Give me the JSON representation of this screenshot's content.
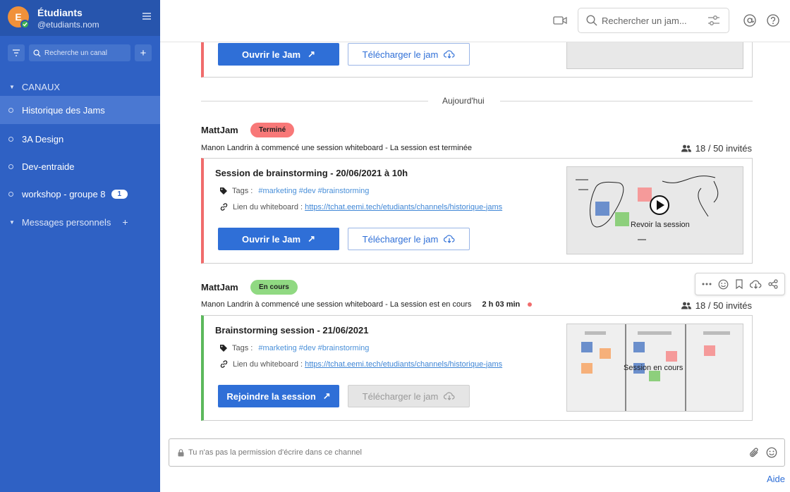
{
  "team": {
    "initial": "E",
    "name": "Étudiants",
    "handle": "@etudiants.nom"
  },
  "sidebar": {
    "search_placeholder": "Recherche un canal",
    "section_channels": "CANAUX",
    "channels": [
      {
        "label": "Historique des Jams",
        "active": true
      },
      {
        "label": "3A Design"
      },
      {
        "label": "Dev-entraide"
      },
      {
        "label": "workshop - groupe 8",
        "badge": "1"
      }
    ],
    "section_dm": "Messages personnels"
  },
  "topbar": {
    "search_placeholder": "Rechercher un jam..."
  },
  "previous_card": {
    "open_label": "Ouvrir le Jam",
    "download_label": "Télécharger le jam"
  },
  "day_separator": "Aujourd'hui",
  "messages": [
    {
      "author": "MattJam",
      "status": "Terminé",
      "description": "Manon Landrin à commencé une session whiteboard - La session est terminée",
      "invites": "18 / 50 invités",
      "card": {
        "title": "Session de brainstorming - 20/06/2021 à 10h",
        "tags_label": "Tags :",
        "tags": [
          "#marketing",
          "#dev",
          "#brainstorming"
        ],
        "link_label": "Lien du whiteboard :",
        "link": "https://tchat.eemi.tech/etudiants/channels/historique-jams",
        "primary_label": "Ouvrir le Jam",
        "download_label": "Télécharger le jam",
        "thumb_label": "Revoir la session"
      }
    },
    {
      "author": "MattJam",
      "status": "En cours",
      "description": "Manon Landrin à commencé une session whiteboard - La session est en cours",
      "duration": "2 h 03 min",
      "invites": "18 / 50 invités",
      "card": {
        "title": "Brainstorming session - 21/06/2021",
        "tags_label": "Tags :",
        "tags": [
          "#marketing",
          "#dev",
          "#brainstorming"
        ],
        "link_label": "Lien du whiteboard :",
        "link": "https://tchat.eemi.tech/etudiants/channels/historique-jams",
        "primary_label": "Rejoindre la session",
        "download_label": "Télécharger le jam",
        "thumb_label": "Session en cours"
      }
    }
  ],
  "composer": {
    "placeholder": "Tu n'as pas la permission d'écrire dans ce channel"
  },
  "help": "Aide"
}
